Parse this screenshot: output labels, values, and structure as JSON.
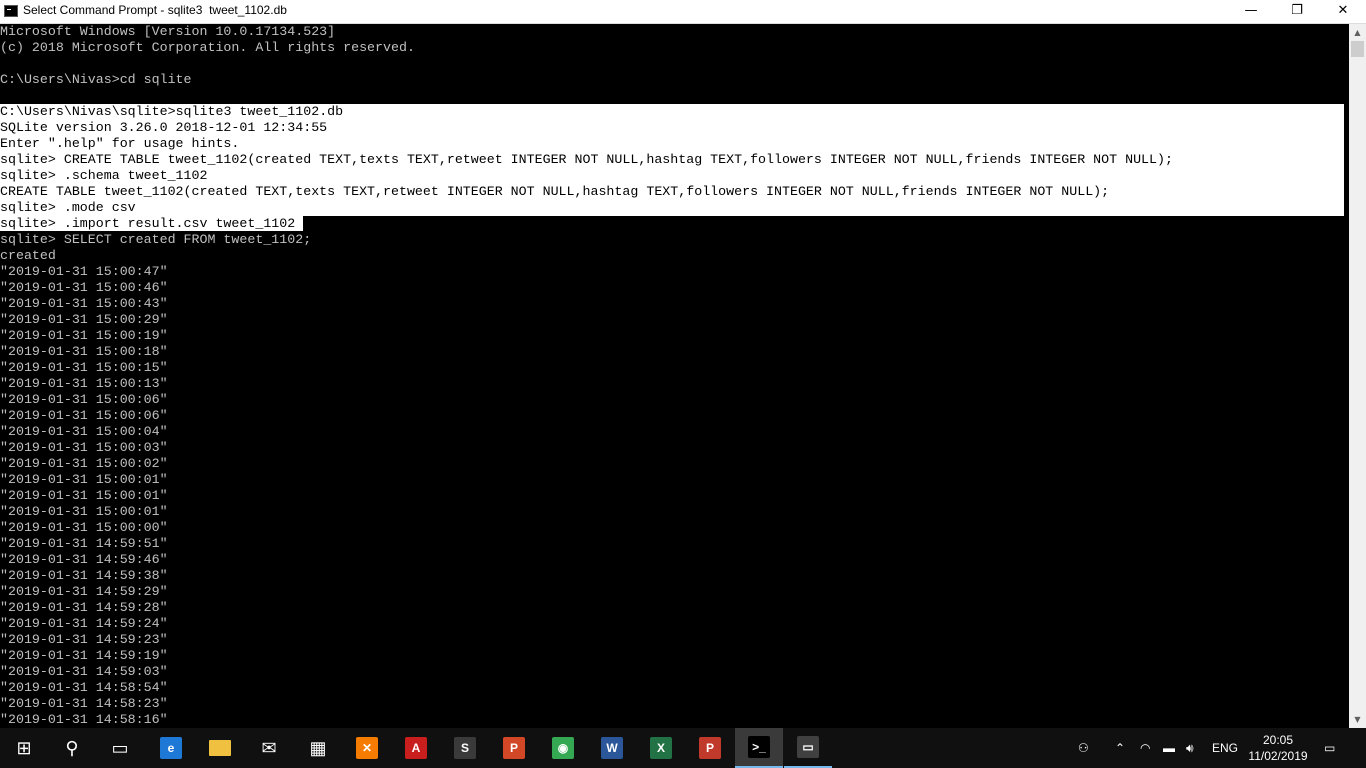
{
  "window": {
    "title": "Select Command Prompt - sqlite3  tweet_1102.db",
    "minimize": "—",
    "maximize": "❐",
    "close": "✕"
  },
  "console": {
    "lines_top": [
      "Microsoft Windows [Version 10.0.17134.523]",
      "(c) 2018 Microsoft Corporation. All rights reserved.",
      "",
      "C:\\Users\\Nivas>cd sqlite",
      ""
    ],
    "prompt_line_prefix": "C:\\Users\\Nivas\\sqlite>",
    "prompt_line_cmd": "sqlite3 tweet_1102.db",
    "highlighted_lines": [
      "SQLite version 3.26.0 2018-12-01 12:34:55",
      "Enter \".help\" for usage hints.",
      "sqlite> CREATE TABLE tweet_1102(created TEXT,texts TEXT,retweet INTEGER NOT NULL,hashtag TEXT,followers INTEGER NOT NULL,friends INTEGER NOT NULL);",
      "sqlite> .schema tweet_1102",
      "CREATE TABLE tweet_1102(created TEXT,texts TEXT,retweet INTEGER NOT NULL,hashtag TEXT,followers INTEGER NOT NULL,friends INTEGER NOT NULL);",
      "sqlite> .mode csv"
    ],
    "import_line": "sqlite> .import result.csv tweet_1102 ",
    "query_line": "sqlite> SELECT created FROM tweet_1102;",
    "header_line": "created",
    "results": [
      "\"2019-01-31 15:00:47\"",
      "\"2019-01-31 15:00:46\"",
      "\"2019-01-31 15:00:43\"",
      "\"2019-01-31 15:00:29\"",
      "\"2019-01-31 15:00:19\"",
      "\"2019-01-31 15:00:18\"",
      "\"2019-01-31 15:00:15\"",
      "\"2019-01-31 15:00:13\"",
      "\"2019-01-31 15:00:06\"",
      "\"2019-01-31 15:00:06\"",
      "\"2019-01-31 15:00:04\"",
      "\"2019-01-31 15:00:03\"",
      "\"2019-01-31 15:00:02\"",
      "\"2019-01-31 15:00:01\"",
      "\"2019-01-31 15:00:01\"",
      "\"2019-01-31 15:00:01\"",
      "\"2019-01-31 15:00:00\"",
      "\"2019-01-31 14:59:51\"",
      "\"2019-01-31 14:59:46\"",
      "\"2019-01-31 14:59:38\"",
      "\"2019-01-31 14:59:29\"",
      "\"2019-01-31 14:59:28\"",
      "\"2019-01-31 14:59:24\"",
      "\"2019-01-31 14:59:23\"",
      "\"2019-01-31 14:59:19\"",
      "\"2019-01-31 14:59:03\"",
      "\"2019-01-31 14:58:54\"",
      "\"2019-01-31 14:58:23\"",
      "\"2019-01-31 14:58:16\""
    ]
  },
  "taskbar": {
    "apps": [
      {
        "name": "start-icon",
        "glyph": "⊞",
        "color": "#101010"
      },
      {
        "name": "search-icon",
        "glyph": "⚲",
        "color": "#101010"
      },
      {
        "name": "task-view-icon",
        "glyph": "▭",
        "color": "#101010"
      },
      {
        "name": "edge-icon",
        "glyph": "e",
        "color": "#1e78d6"
      },
      {
        "name": "file-explorer-icon",
        "glyph": "",
        "color": "#f0c040"
      },
      {
        "name": "mail-icon",
        "glyph": "✉",
        "color": "#101010"
      },
      {
        "name": "store-icon",
        "glyph": "▦",
        "color": "#101010"
      },
      {
        "name": "xampp-icon",
        "glyph": "✕",
        "color": "#f57c00"
      },
      {
        "name": "acrobat-icon",
        "glyph": "A",
        "color": "#c81e1e"
      },
      {
        "name": "sublime-icon",
        "glyph": "S",
        "color": "#3a3a3a"
      },
      {
        "name": "powerpoint-icon",
        "glyph": "P",
        "color": "#d24726"
      },
      {
        "name": "chrome-icon",
        "glyph": "◉",
        "color": "#34a853"
      },
      {
        "name": "word-icon",
        "glyph": "W",
        "color": "#2b579a"
      },
      {
        "name": "excel-icon",
        "glyph": "X",
        "color": "#217346"
      },
      {
        "name": "postman-icon",
        "glyph": "P",
        "color": "#c0392b"
      },
      {
        "name": "cmd-icon",
        "glyph": ">_",
        "color": "#000000"
      },
      {
        "name": "window-icon",
        "glyph": "▭",
        "color": "#404040"
      }
    ],
    "tray": {
      "language": "ENG",
      "time": "20:05",
      "date": "11/02/2019"
    }
  }
}
